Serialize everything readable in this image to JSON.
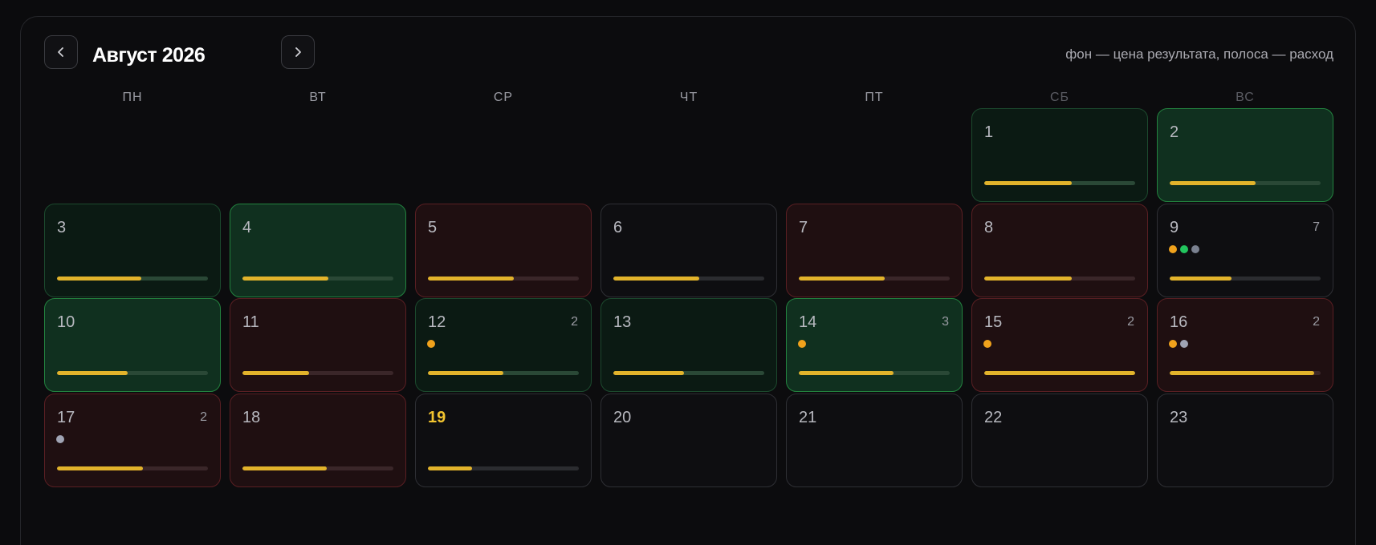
{
  "header": {
    "month_title": "Август 2026",
    "legend": "фон — цена результата, полоса — расход",
    "prev_icon": "chevron-left-icon",
    "next_icon": "chevron-right-icon"
  },
  "weekdays": [
    {
      "label": "ПН",
      "weekend": false
    },
    {
      "label": "ВТ",
      "weekend": false
    },
    {
      "label": "СР",
      "weekend": false
    },
    {
      "label": "ЧТ",
      "weekend": false
    },
    {
      "label": "ПТ",
      "weekend": false
    },
    {
      "label": "СБ",
      "weekend": true
    },
    {
      "label": "ВС",
      "weekend": true
    }
  ],
  "colors": {
    "bar": "#e2b32b",
    "dot_orange": "#f0a21c",
    "dot_green": "#22c55e",
    "dot_slate": "#7a8190",
    "dot_gray": "#a0a4b4",
    "today": "#f2c42f"
  },
  "days": [
    {
      "day": "1",
      "col": 5,
      "row": 0,
      "tone": "green-dark",
      "spend": 0.58,
      "count": "",
      "dots": []
    },
    {
      "day": "2",
      "col": 6,
      "row": 0,
      "tone": "green-bright",
      "spend": 0.57,
      "count": "",
      "dots": []
    },
    {
      "day": "3",
      "col": 0,
      "row": 1,
      "tone": "green-dark",
      "spend": 0.56,
      "count": "",
      "dots": []
    },
    {
      "day": "4",
      "col": 1,
      "row": 1,
      "tone": "green-bright",
      "spend": 0.57,
      "count": "",
      "dots": []
    },
    {
      "day": "5",
      "col": 2,
      "row": 1,
      "tone": "red",
      "spend": 0.57,
      "count": "",
      "dots": []
    },
    {
      "day": "6",
      "col": 3,
      "row": 1,
      "tone": "neutral",
      "spend": 0.57,
      "count": "",
      "dots": []
    },
    {
      "day": "7",
      "col": 4,
      "row": 1,
      "tone": "red",
      "spend": 0.57,
      "count": "",
      "dots": []
    },
    {
      "day": "8",
      "col": 5,
      "row": 1,
      "tone": "red",
      "spend": 0.58,
      "count": "",
      "dots": []
    },
    {
      "day": "9",
      "col": 6,
      "row": 1,
      "tone": "neutral",
      "spend": 0.41,
      "count": "7",
      "dots": [
        "dot_orange",
        "dot_green",
        "dot_slate"
      ]
    },
    {
      "day": "10",
      "col": 0,
      "row": 2,
      "tone": "green-bright",
      "spend": 0.47,
      "count": "",
      "dots": []
    },
    {
      "day": "11",
      "col": 1,
      "row": 2,
      "tone": "red",
      "spend": 0.44,
      "count": "",
      "dots": []
    },
    {
      "day": "12",
      "col": 2,
      "row": 2,
      "tone": "green-dark",
      "spend": 0.5,
      "count": "2",
      "dots": [
        "dot_orange"
      ]
    },
    {
      "day": "13",
      "col": 3,
      "row": 2,
      "tone": "green-dark",
      "spend": 0.47,
      "count": "",
      "dots": []
    },
    {
      "day": "14",
      "col": 4,
      "row": 2,
      "tone": "green-bright",
      "spend": 0.63,
      "count": "3",
      "dots": [
        "dot_orange"
      ]
    },
    {
      "day": "15",
      "col": 5,
      "row": 2,
      "tone": "red",
      "spend": 1.0,
      "count": "2",
      "dots": [
        "dot_orange"
      ]
    },
    {
      "day": "16",
      "col": 6,
      "row": 2,
      "tone": "red",
      "spend": 0.96,
      "count": "2",
      "dots": [
        "dot_orange",
        "dot_gray"
      ]
    },
    {
      "day": "17",
      "col": 0,
      "row": 3,
      "tone": "red",
      "spend": 0.57,
      "count": "2",
      "dots": [
        "dot_gray"
      ]
    },
    {
      "day": "18",
      "col": 1,
      "row": 3,
      "tone": "red",
      "spend": 0.56,
      "count": "",
      "dots": []
    },
    {
      "day": "19",
      "col": 2,
      "row": 3,
      "tone": "neutral",
      "spend": 0.29,
      "count": "",
      "dots": [],
      "today": true
    },
    {
      "day": "20",
      "col": 3,
      "row": 3,
      "tone": "neutral",
      "spend": null,
      "count": "",
      "dots": []
    },
    {
      "day": "21",
      "col": 4,
      "row": 3,
      "tone": "neutral",
      "spend": null,
      "count": "",
      "dots": []
    },
    {
      "day": "22",
      "col": 5,
      "row": 3,
      "tone": "neutral",
      "spend": null,
      "count": "",
      "dots": []
    },
    {
      "day": "23",
      "col": 6,
      "row": 3,
      "tone": "neutral",
      "spend": null,
      "count": "",
      "dots": []
    }
  ]
}
